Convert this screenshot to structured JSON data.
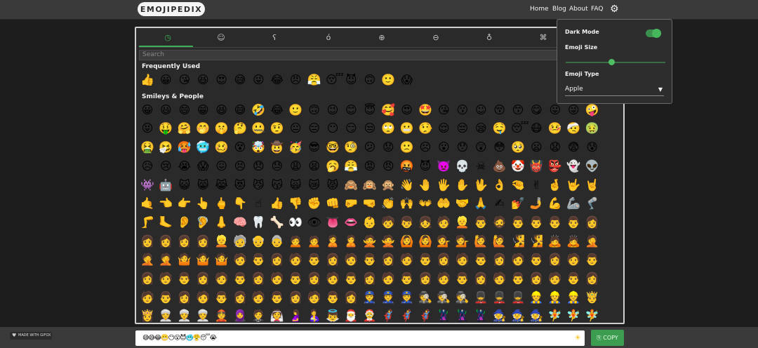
{
  "header": {
    "logo_text": "EMOJIPEDIX",
    "nav": [
      {
        "label": "Home"
      },
      {
        "label": "Blog"
      },
      {
        "label": "About"
      },
      {
        "label": "FAQ"
      }
    ],
    "settings_icon": "gear-icon"
  },
  "picker": {
    "tabs": [
      {
        "icon": "clock-icon",
        "glyph": "◷",
        "name": "recent"
      },
      {
        "icon": "smiley-icon",
        "glyph": "☺",
        "name": "smileys"
      },
      {
        "icon": "bear-icon",
        "glyph": "ʕ",
        "name": "animals"
      },
      {
        "icon": "apple-icon",
        "glyph": "ó",
        "name": "food"
      },
      {
        "icon": "globe-icon",
        "glyph": "⊕",
        "name": "travel"
      },
      {
        "icon": "car-icon",
        "glyph": "⊖",
        "name": "activities"
      },
      {
        "icon": "lightbulb-icon",
        "glyph": "♁",
        "name": "objects"
      },
      {
        "icon": "symbols-icon",
        "glyph": "⌘",
        "name": "symbols"
      }
    ],
    "search_placeholder": "Search",
    "sections": [
      {
        "title": "Frequently Used",
        "rows": [
          [
            "👍",
            "😀",
            "😘",
            "😆",
            "😍",
            "😅",
            "😜",
            "😂",
            "😠",
            "😤",
            "😴",
            "😈",
            "🙃",
            "🙂",
            "😱"
          ]
        ]
      },
      {
        "title": "Smileys & People",
        "rows": [
          [
            "😀",
            "😃",
            "😄",
            "😁",
            "😆",
            "😅",
            "🤣",
            "😂",
            "🙂",
            "🙃",
            "😉",
            "😊",
            "😇",
            "🥰",
            "😍",
            "🤩",
            "😘",
            "😗",
            "☺",
            "😚",
            "😙",
            "😋",
            "😛",
            "😜",
            "🤪"
          ],
          [
            "😝",
            "🤑",
            "🤗",
            "🤭",
            "🤫",
            "🤔",
            "🤐",
            "🤨",
            "😐",
            "😑",
            "😶",
            "😏",
            "😒",
            "🙄",
            "😬",
            "🤥",
            "😌",
            "😔",
            "😪",
            "🤤",
            "😴",
            "😷",
            "🤒",
            "🤕",
            "🤢"
          ],
          [
            "🤮",
            "🤧",
            "🥵",
            "🥶",
            "🥴",
            "😵",
            "🤯",
            "🤠",
            "🥳",
            "😎",
            "🤓",
            "🧐",
            "😕",
            "😟",
            "🙁",
            "☹",
            "😮",
            "😯",
            "😲",
            "😳",
            "🥺",
            "😦",
            "😧",
            "😨",
            "😰"
          ],
          [
            "😥",
            "😢",
            "😭",
            "😱",
            "😖",
            "😣",
            "😞",
            "😓",
            "😩",
            "😫",
            "🥱",
            "😤",
            "😡",
            "😠",
            "🤬",
            "😈",
            "👿",
            "💀",
            "☠",
            "💩",
            "🤡",
            "👹",
            "👺",
            "👻",
            "👽"
          ],
          [
            "👾",
            "🤖",
            "😺",
            "😸",
            "😹",
            "😻",
            "😼",
            "😽",
            "🙀",
            "😿",
            "😾",
            "🙈",
            "🙉",
            "🙊",
            "👋",
            "🤚",
            "🖐",
            "✋",
            "🖖",
            "👌",
            "🤏",
            "✌",
            "🤞",
            "🤟",
            "🤘"
          ],
          [
            "🤙",
            "👈",
            "👉",
            "👆",
            "🖕",
            "👇",
            "☝",
            "👍",
            "👎",
            "✊",
            "👊",
            "🤛",
            "🤜",
            "👏",
            "🙌",
            "👐",
            "🤲",
            "🤝",
            "🙏",
            "✍",
            "💅",
            "🤳",
            "💪",
            "🦾",
            "🦿"
          ],
          [
            "🦵",
            "🦶",
            "👂",
            "🦻",
            "👃",
            "🧠",
            "🦷",
            "🦴",
            "👀",
            "👁",
            "👅",
            "👄",
            "👶",
            "🧒",
            "👦",
            "👧",
            "🧑",
            "👱",
            "👨",
            "🧔",
            "👨",
            "👨",
            "👨",
            "👨",
            "👩"
          ],
          [
            "👩",
            "👩",
            "👩",
            "👩",
            "👱",
            "🧓",
            "👴",
            "👵",
            "🙍",
            "🙍",
            "🙎",
            "🙎",
            "🙅",
            "🙅",
            "🙆",
            "🙆",
            "💁",
            "💁",
            "🙋",
            "🙋",
            "🧏",
            "🧏",
            "🙇",
            "🙇",
            "🤦"
          ],
          [
            "🤦",
            "🤦",
            "🤷",
            "🤷",
            "🤷",
            "🧑",
            "👨",
            "👩",
            "🧑",
            "👨",
            "👩",
            "🧑",
            "👨",
            "👩",
            "🧑",
            "👨",
            "👩",
            "🧑",
            "👨",
            "👩",
            "🧑",
            "👨",
            "👩",
            "🧑",
            "👨"
          ],
          [
            "👩",
            "🧑",
            "👨",
            "👩",
            "🧑",
            "👨",
            "👩",
            "🧑",
            "👨",
            "👩",
            "🧑",
            "👨",
            "👩",
            "🧑",
            "👨",
            "👩",
            "🧑",
            "👨",
            "👩",
            "🧑",
            "👨",
            "👩",
            "🧑",
            "👨",
            "👩"
          ],
          [
            "🧑",
            "👨",
            "👩",
            "🧑",
            "👨",
            "👩",
            "🧑",
            "👨",
            "👩",
            "🧑",
            "👨",
            "👩",
            "👮",
            "👮",
            "👮",
            "🕵",
            "🕵",
            "🕵",
            "💂",
            "💂",
            "💂",
            "👷",
            "👷",
            "👷",
            "🤴"
          ],
          [
            "👸",
            "👳",
            "👳",
            "👳",
            "👲",
            "🧕",
            "🤵",
            "👰",
            "🤰",
            "🤱",
            "👼",
            "🎅",
            "🤶",
            "🦸",
            "🦸",
            "🦸",
            "🦹",
            "🦹",
            "🦹",
            "🧙",
            "🧙",
            "🧙",
            "🧚",
            "🧚",
            "🧚"
          ]
        ]
      }
    ]
  },
  "settings_panel": {
    "dark_mode_label": "Dark Mode",
    "dark_mode_on": true,
    "emoji_size_label": "Emoji Size",
    "emoji_size_value": 0.48,
    "emoji_type_label": "Emoji Type",
    "emoji_type_value": "Apple"
  },
  "footer": {
    "made_with": "MADE WITH GIFOX",
    "output_text": "😅😅😂😬😶😮😈🥶😤😴😭",
    "copy_label": "COPY",
    "copy_icon": "copy-icon",
    "theme_icon": "sun-icon"
  },
  "colors": {
    "accent": "#3c9c4f",
    "panel_bg": "#2d2d2d",
    "page_bg": "#1d1d1d"
  }
}
